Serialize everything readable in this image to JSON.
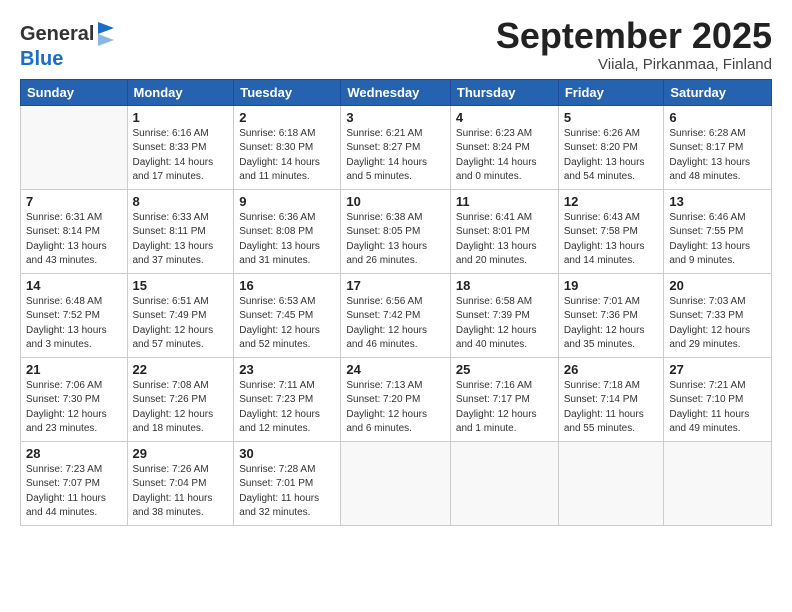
{
  "header": {
    "logo_general": "General",
    "logo_blue": "Blue",
    "month_title": "September 2025",
    "location": "Viiala, Pirkanmaa, Finland"
  },
  "columns": [
    "Sunday",
    "Monday",
    "Tuesday",
    "Wednesday",
    "Thursday",
    "Friday",
    "Saturday"
  ],
  "weeks": [
    [
      {
        "day": "",
        "detail": ""
      },
      {
        "day": "1",
        "detail": "Sunrise: 6:16 AM\nSunset: 8:33 PM\nDaylight: 14 hours\nand 17 minutes."
      },
      {
        "day": "2",
        "detail": "Sunrise: 6:18 AM\nSunset: 8:30 PM\nDaylight: 14 hours\nand 11 minutes."
      },
      {
        "day": "3",
        "detail": "Sunrise: 6:21 AM\nSunset: 8:27 PM\nDaylight: 14 hours\nand 5 minutes."
      },
      {
        "day": "4",
        "detail": "Sunrise: 6:23 AM\nSunset: 8:24 PM\nDaylight: 14 hours\nand 0 minutes."
      },
      {
        "day": "5",
        "detail": "Sunrise: 6:26 AM\nSunset: 8:20 PM\nDaylight: 13 hours\nand 54 minutes."
      },
      {
        "day": "6",
        "detail": "Sunrise: 6:28 AM\nSunset: 8:17 PM\nDaylight: 13 hours\nand 48 minutes."
      }
    ],
    [
      {
        "day": "7",
        "detail": "Sunrise: 6:31 AM\nSunset: 8:14 PM\nDaylight: 13 hours\nand 43 minutes."
      },
      {
        "day": "8",
        "detail": "Sunrise: 6:33 AM\nSunset: 8:11 PM\nDaylight: 13 hours\nand 37 minutes."
      },
      {
        "day": "9",
        "detail": "Sunrise: 6:36 AM\nSunset: 8:08 PM\nDaylight: 13 hours\nand 31 minutes."
      },
      {
        "day": "10",
        "detail": "Sunrise: 6:38 AM\nSunset: 8:05 PM\nDaylight: 13 hours\nand 26 minutes."
      },
      {
        "day": "11",
        "detail": "Sunrise: 6:41 AM\nSunset: 8:01 PM\nDaylight: 13 hours\nand 20 minutes."
      },
      {
        "day": "12",
        "detail": "Sunrise: 6:43 AM\nSunset: 7:58 PM\nDaylight: 13 hours\nand 14 minutes."
      },
      {
        "day": "13",
        "detail": "Sunrise: 6:46 AM\nSunset: 7:55 PM\nDaylight: 13 hours\nand 9 minutes."
      }
    ],
    [
      {
        "day": "14",
        "detail": "Sunrise: 6:48 AM\nSunset: 7:52 PM\nDaylight: 13 hours\nand 3 minutes."
      },
      {
        "day": "15",
        "detail": "Sunrise: 6:51 AM\nSunset: 7:49 PM\nDaylight: 12 hours\nand 57 minutes."
      },
      {
        "day": "16",
        "detail": "Sunrise: 6:53 AM\nSunset: 7:45 PM\nDaylight: 12 hours\nand 52 minutes."
      },
      {
        "day": "17",
        "detail": "Sunrise: 6:56 AM\nSunset: 7:42 PM\nDaylight: 12 hours\nand 46 minutes."
      },
      {
        "day": "18",
        "detail": "Sunrise: 6:58 AM\nSunset: 7:39 PM\nDaylight: 12 hours\nand 40 minutes."
      },
      {
        "day": "19",
        "detail": "Sunrise: 7:01 AM\nSunset: 7:36 PM\nDaylight: 12 hours\nand 35 minutes."
      },
      {
        "day": "20",
        "detail": "Sunrise: 7:03 AM\nSunset: 7:33 PM\nDaylight: 12 hours\nand 29 minutes."
      }
    ],
    [
      {
        "day": "21",
        "detail": "Sunrise: 7:06 AM\nSunset: 7:30 PM\nDaylight: 12 hours\nand 23 minutes."
      },
      {
        "day": "22",
        "detail": "Sunrise: 7:08 AM\nSunset: 7:26 PM\nDaylight: 12 hours\nand 18 minutes."
      },
      {
        "day": "23",
        "detail": "Sunrise: 7:11 AM\nSunset: 7:23 PM\nDaylight: 12 hours\nand 12 minutes."
      },
      {
        "day": "24",
        "detail": "Sunrise: 7:13 AM\nSunset: 7:20 PM\nDaylight: 12 hours\nand 6 minutes."
      },
      {
        "day": "25",
        "detail": "Sunrise: 7:16 AM\nSunset: 7:17 PM\nDaylight: 12 hours\nand 1 minute."
      },
      {
        "day": "26",
        "detail": "Sunrise: 7:18 AM\nSunset: 7:14 PM\nDaylight: 11 hours\nand 55 minutes."
      },
      {
        "day": "27",
        "detail": "Sunrise: 7:21 AM\nSunset: 7:10 PM\nDaylight: 11 hours\nand 49 minutes."
      }
    ],
    [
      {
        "day": "28",
        "detail": "Sunrise: 7:23 AM\nSunset: 7:07 PM\nDaylight: 11 hours\nand 44 minutes."
      },
      {
        "day": "29",
        "detail": "Sunrise: 7:26 AM\nSunset: 7:04 PM\nDaylight: 11 hours\nand 38 minutes."
      },
      {
        "day": "30",
        "detail": "Sunrise: 7:28 AM\nSunset: 7:01 PM\nDaylight: 11 hours\nand 32 minutes."
      },
      {
        "day": "",
        "detail": ""
      },
      {
        "day": "",
        "detail": ""
      },
      {
        "day": "",
        "detail": ""
      },
      {
        "day": "",
        "detail": ""
      }
    ]
  ]
}
